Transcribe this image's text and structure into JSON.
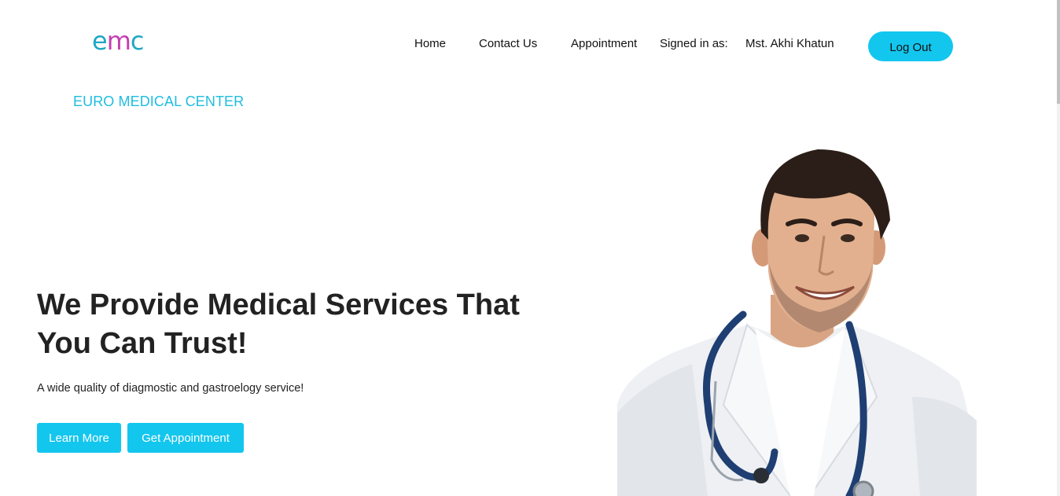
{
  "logo": {
    "e": "e",
    "m": "m",
    "c": "c"
  },
  "brand_name": "EURO MEDICAL CENTER",
  "nav": {
    "home": "Home",
    "contact": "Contact Us",
    "appointment": "Appointment",
    "signed_in_label": "Signed in as:",
    "user_name": "Mst. Akhi Khatun",
    "logout": "Log Out"
  },
  "hero": {
    "title": "We Provide Medical Services That You Can Trust!",
    "subtitle": "A wide quality of diagmostic and gastroelogy service!",
    "learn_more": "Learn More",
    "get_appointment": "Get Appointment",
    "image": "doctor-with-stethoscope"
  },
  "colors": {
    "accent": "#13c6ee",
    "brand_text": "#1fbde0",
    "logo_teal": "#22a8c4",
    "logo_magenta": "#c43fb0"
  }
}
